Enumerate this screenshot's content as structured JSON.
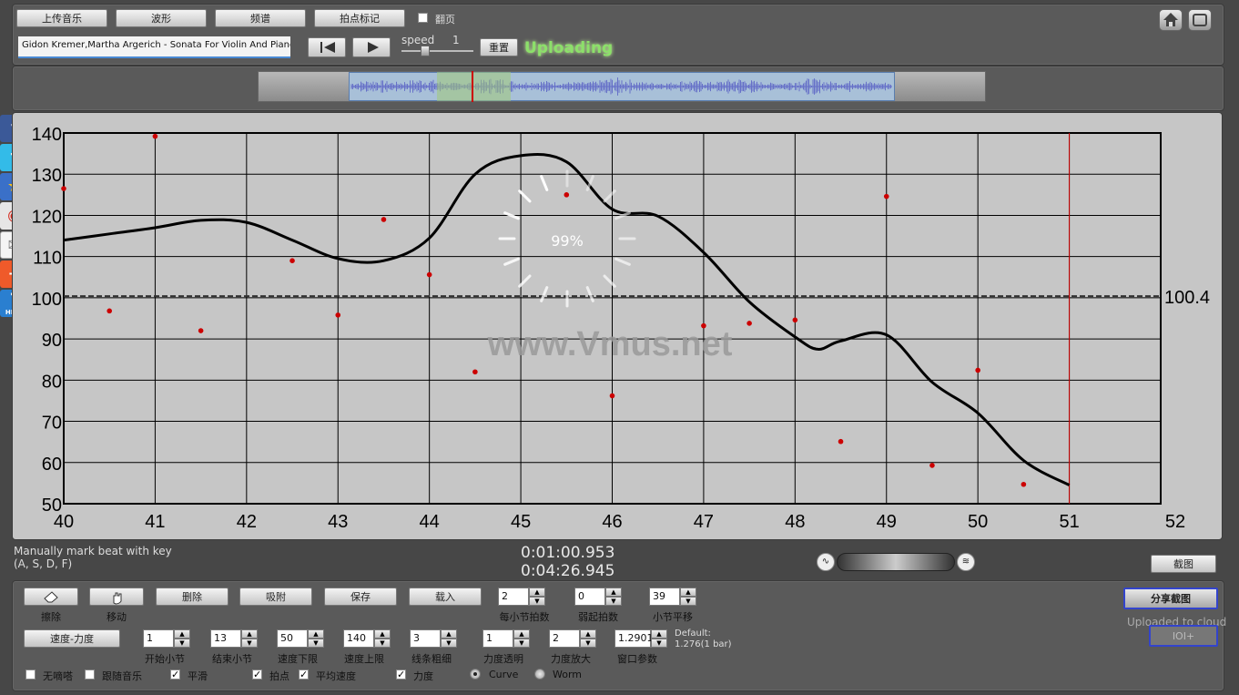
{
  "top": {
    "upload_label": "上传音乐",
    "waveform_label": "波形",
    "spectrum_label": "频谱",
    "beat_mark_label": "拍点标记",
    "page_turn_label": "翻页",
    "track_title": "Gidon Kremer,Martha Argerich - Sonata For Violin And Piano",
    "speed_label": "speed",
    "speed_value": "1",
    "reset_label": "重置",
    "status_text": "Uploading"
  },
  "social": {
    "facebook": "f",
    "twitter": "t",
    "help": "HELP"
  },
  "chart_data": {
    "type": "line",
    "x_ticks": [
      "40",
      "41",
      "42",
      "43",
      "44",
      "45",
      "46",
      "47",
      "48",
      "49",
      "50",
      "51",
      "52"
    ],
    "y_ticks": [
      "140",
      "130",
      "120",
      "110",
      "100",
      "90",
      "80",
      "70",
      "60",
      "50"
    ],
    "xlim": [
      40,
      52
    ],
    "ylim": [
      50,
      140
    ],
    "grid": true,
    "reference_line": {
      "value": 100.4,
      "label": "100.4"
    },
    "cursor_x": 51,
    "watermark": "www.Vmus.net",
    "progress_text": "99%",
    "progress_fraction": 0.99,
    "curve": {
      "x": [
        40,
        40.5,
        41,
        41.5,
        42,
        42.5,
        43,
        43.5,
        44,
        44.5,
        45,
        45.5,
        46,
        46.5,
        47,
        47.5,
        48,
        48.25,
        48.5,
        49,
        49.5,
        50,
        50.5,
        51
      ],
      "y": [
        114,
        115.5,
        117,
        118.8,
        118.3,
        114,
        109.5,
        109,
        114.5,
        130,
        134.5,
        133,
        121.5,
        119.8,
        111,
        99,
        90.5,
        87.5,
        89.5,
        91,
        79.5,
        72,
        60.5,
        54.5
      ]
    },
    "points": {
      "x": [
        40,
        40.5,
        41,
        41.5,
        42.5,
        43,
        43.5,
        44,
        44.5,
        45.5,
        46,
        47,
        47.5,
        48,
        48.5,
        49,
        49.5,
        50,
        50.5
      ],
      "y": [
        126.5,
        96.8,
        139.2,
        92,
        109,
        95.8,
        119,
        105.6,
        82,
        125,
        76.2,
        93.2,
        93.8,
        94.6,
        65.1,
        124.6,
        59.3,
        82.4,
        54.7
      ]
    },
    "colors": {
      "curve": "#000000",
      "points": "#cc0000",
      "reference": "#333333",
      "cursor": "#cc0000"
    }
  },
  "info": {
    "hint_line1": "Manually mark beat with key",
    "hint_line2": "(A, S, D, F)",
    "current_time": "0:01:00.953",
    "total_time": "0:04:26.945",
    "screenshot_label": "截图"
  },
  "controls": {
    "erase_label": "擦除",
    "move_label": "移动",
    "delete_label": "删除",
    "snap_label": "吸附",
    "save_label": "保存",
    "load_label": "载入",
    "beats_per_bar": {
      "value": "2",
      "label": "每小节拍数"
    },
    "weak_beats": {
      "value": "0",
      "label": "弱起拍数"
    },
    "bar_offset": {
      "value": "39",
      "label": "小节平移"
    },
    "mode_label": "速度-力度",
    "start_bar": {
      "value": "1",
      "label": "开始小节"
    },
    "end_bar": {
      "value": "13",
      "label": "结束小节"
    },
    "tempo_min": {
      "value": "50",
      "label": "速度下限"
    },
    "tempo_max": {
      "value": "140",
      "label": "速度上限"
    },
    "line_width": {
      "value": "3",
      "label": "线条粗细"
    },
    "dyn_transparency": {
      "value": "1",
      "label": "力度透明"
    },
    "dyn_scale": {
      "value": "2",
      "label": "力度放大"
    },
    "window_param": {
      "value": "1.2901",
      "label": "窗口参数"
    },
    "default_line1": "Default:",
    "default_line2": "1.276(1 bar)",
    "share_label": "分享截图",
    "uploaded_text": "Uploaded to cloud",
    "ioi_label": "IOI+",
    "no_beat_label": "无嘀嗒",
    "follow_music_label": "跟随音乐",
    "smooth_label": "平滑",
    "beat_points_label": "拍点",
    "avg_tempo_label": "平均速度",
    "dynamics_label": "力度",
    "curve_label": "Curve",
    "worm_label": "Worm"
  }
}
